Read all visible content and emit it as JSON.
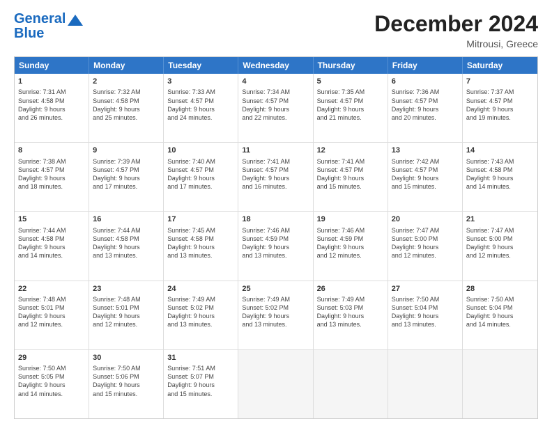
{
  "header": {
    "logo_line1": "General",
    "logo_line2": "Blue",
    "month_title": "December 2024",
    "location": "Mitrousi, Greece"
  },
  "weekdays": [
    "Sunday",
    "Monday",
    "Tuesday",
    "Wednesday",
    "Thursday",
    "Friday",
    "Saturday"
  ],
  "rows": [
    [
      {
        "day": "1",
        "lines": [
          "Sunrise: 7:31 AM",
          "Sunset: 4:58 PM",
          "Daylight: 9 hours",
          "and 26 minutes."
        ]
      },
      {
        "day": "2",
        "lines": [
          "Sunrise: 7:32 AM",
          "Sunset: 4:58 PM",
          "Daylight: 9 hours",
          "and 25 minutes."
        ]
      },
      {
        "day": "3",
        "lines": [
          "Sunrise: 7:33 AM",
          "Sunset: 4:57 PM",
          "Daylight: 9 hours",
          "and 24 minutes."
        ]
      },
      {
        "day": "4",
        "lines": [
          "Sunrise: 7:34 AM",
          "Sunset: 4:57 PM",
          "Daylight: 9 hours",
          "and 22 minutes."
        ]
      },
      {
        "day": "5",
        "lines": [
          "Sunrise: 7:35 AM",
          "Sunset: 4:57 PM",
          "Daylight: 9 hours",
          "and 21 minutes."
        ]
      },
      {
        "day": "6",
        "lines": [
          "Sunrise: 7:36 AM",
          "Sunset: 4:57 PM",
          "Daylight: 9 hours",
          "and 20 minutes."
        ]
      },
      {
        "day": "7",
        "lines": [
          "Sunrise: 7:37 AM",
          "Sunset: 4:57 PM",
          "Daylight: 9 hours",
          "and 19 minutes."
        ]
      }
    ],
    [
      {
        "day": "8",
        "lines": [
          "Sunrise: 7:38 AM",
          "Sunset: 4:57 PM",
          "Daylight: 9 hours",
          "and 18 minutes."
        ]
      },
      {
        "day": "9",
        "lines": [
          "Sunrise: 7:39 AM",
          "Sunset: 4:57 PM",
          "Daylight: 9 hours",
          "and 17 minutes."
        ]
      },
      {
        "day": "10",
        "lines": [
          "Sunrise: 7:40 AM",
          "Sunset: 4:57 PM",
          "Daylight: 9 hours",
          "and 17 minutes."
        ]
      },
      {
        "day": "11",
        "lines": [
          "Sunrise: 7:41 AM",
          "Sunset: 4:57 PM",
          "Daylight: 9 hours",
          "and 16 minutes."
        ]
      },
      {
        "day": "12",
        "lines": [
          "Sunrise: 7:41 AM",
          "Sunset: 4:57 PM",
          "Daylight: 9 hours",
          "and 15 minutes."
        ]
      },
      {
        "day": "13",
        "lines": [
          "Sunrise: 7:42 AM",
          "Sunset: 4:57 PM",
          "Daylight: 9 hours",
          "and 15 minutes."
        ]
      },
      {
        "day": "14",
        "lines": [
          "Sunrise: 7:43 AM",
          "Sunset: 4:58 PM",
          "Daylight: 9 hours",
          "and 14 minutes."
        ]
      }
    ],
    [
      {
        "day": "15",
        "lines": [
          "Sunrise: 7:44 AM",
          "Sunset: 4:58 PM",
          "Daylight: 9 hours",
          "and 14 minutes."
        ]
      },
      {
        "day": "16",
        "lines": [
          "Sunrise: 7:44 AM",
          "Sunset: 4:58 PM",
          "Daylight: 9 hours",
          "and 13 minutes."
        ]
      },
      {
        "day": "17",
        "lines": [
          "Sunrise: 7:45 AM",
          "Sunset: 4:58 PM",
          "Daylight: 9 hours",
          "and 13 minutes."
        ]
      },
      {
        "day": "18",
        "lines": [
          "Sunrise: 7:46 AM",
          "Sunset: 4:59 PM",
          "Daylight: 9 hours",
          "and 13 minutes."
        ]
      },
      {
        "day": "19",
        "lines": [
          "Sunrise: 7:46 AM",
          "Sunset: 4:59 PM",
          "Daylight: 9 hours",
          "and 12 minutes."
        ]
      },
      {
        "day": "20",
        "lines": [
          "Sunrise: 7:47 AM",
          "Sunset: 5:00 PM",
          "Daylight: 9 hours",
          "and 12 minutes."
        ]
      },
      {
        "day": "21",
        "lines": [
          "Sunrise: 7:47 AM",
          "Sunset: 5:00 PM",
          "Daylight: 9 hours",
          "and 12 minutes."
        ]
      }
    ],
    [
      {
        "day": "22",
        "lines": [
          "Sunrise: 7:48 AM",
          "Sunset: 5:01 PM",
          "Daylight: 9 hours",
          "and 12 minutes."
        ]
      },
      {
        "day": "23",
        "lines": [
          "Sunrise: 7:48 AM",
          "Sunset: 5:01 PM",
          "Daylight: 9 hours",
          "and 12 minutes."
        ]
      },
      {
        "day": "24",
        "lines": [
          "Sunrise: 7:49 AM",
          "Sunset: 5:02 PM",
          "Daylight: 9 hours",
          "and 13 minutes."
        ]
      },
      {
        "day": "25",
        "lines": [
          "Sunrise: 7:49 AM",
          "Sunset: 5:02 PM",
          "Daylight: 9 hours",
          "and 13 minutes."
        ]
      },
      {
        "day": "26",
        "lines": [
          "Sunrise: 7:49 AM",
          "Sunset: 5:03 PM",
          "Daylight: 9 hours",
          "and 13 minutes."
        ]
      },
      {
        "day": "27",
        "lines": [
          "Sunrise: 7:50 AM",
          "Sunset: 5:04 PM",
          "Daylight: 9 hours",
          "and 13 minutes."
        ]
      },
      {
        "day": "28",
        "lines": [
          "Sunrise: 7:50 AM",
          "Sunset: 5:04 PM",
          "Daylight: 9 hours",
          "and 14 minutes."
        ]
      }
    ],
    [
      {
        "day": "29",
        "lines": [
          "Sunrise: 7:50 AM",
          "Sunset: 5:05 PM",
          "Daylight: 9 hours",
          "and 14 minutes."
        ]
      },
      {
        "day": "30",
        "lines": [
          "Sunrise: 7:50 AM",
          "Sunset: 5:06 PM",
          "Daylight: 9 hours",
          "and 15 minutes."
        ]
      },
      {
        "day": "31",
        "lines": [
          "Sunrise: 7:51 AM",
          "Sunset: 5:07 PM",
          "Daylight: 9 hours",
          "and 15 minutes."
        ]
      },
      {
        "day": "",
        "lines": [],
        "empty": true
      },
      {
        "day": "",
        "lines": [],
        "empty": true
      },
      {
        "day": "",
        "lines": [],
        "empty": true
      },
      {
        "day": "",
        "lines": [],
        "empty": true
      }
    ]
  ]
}
